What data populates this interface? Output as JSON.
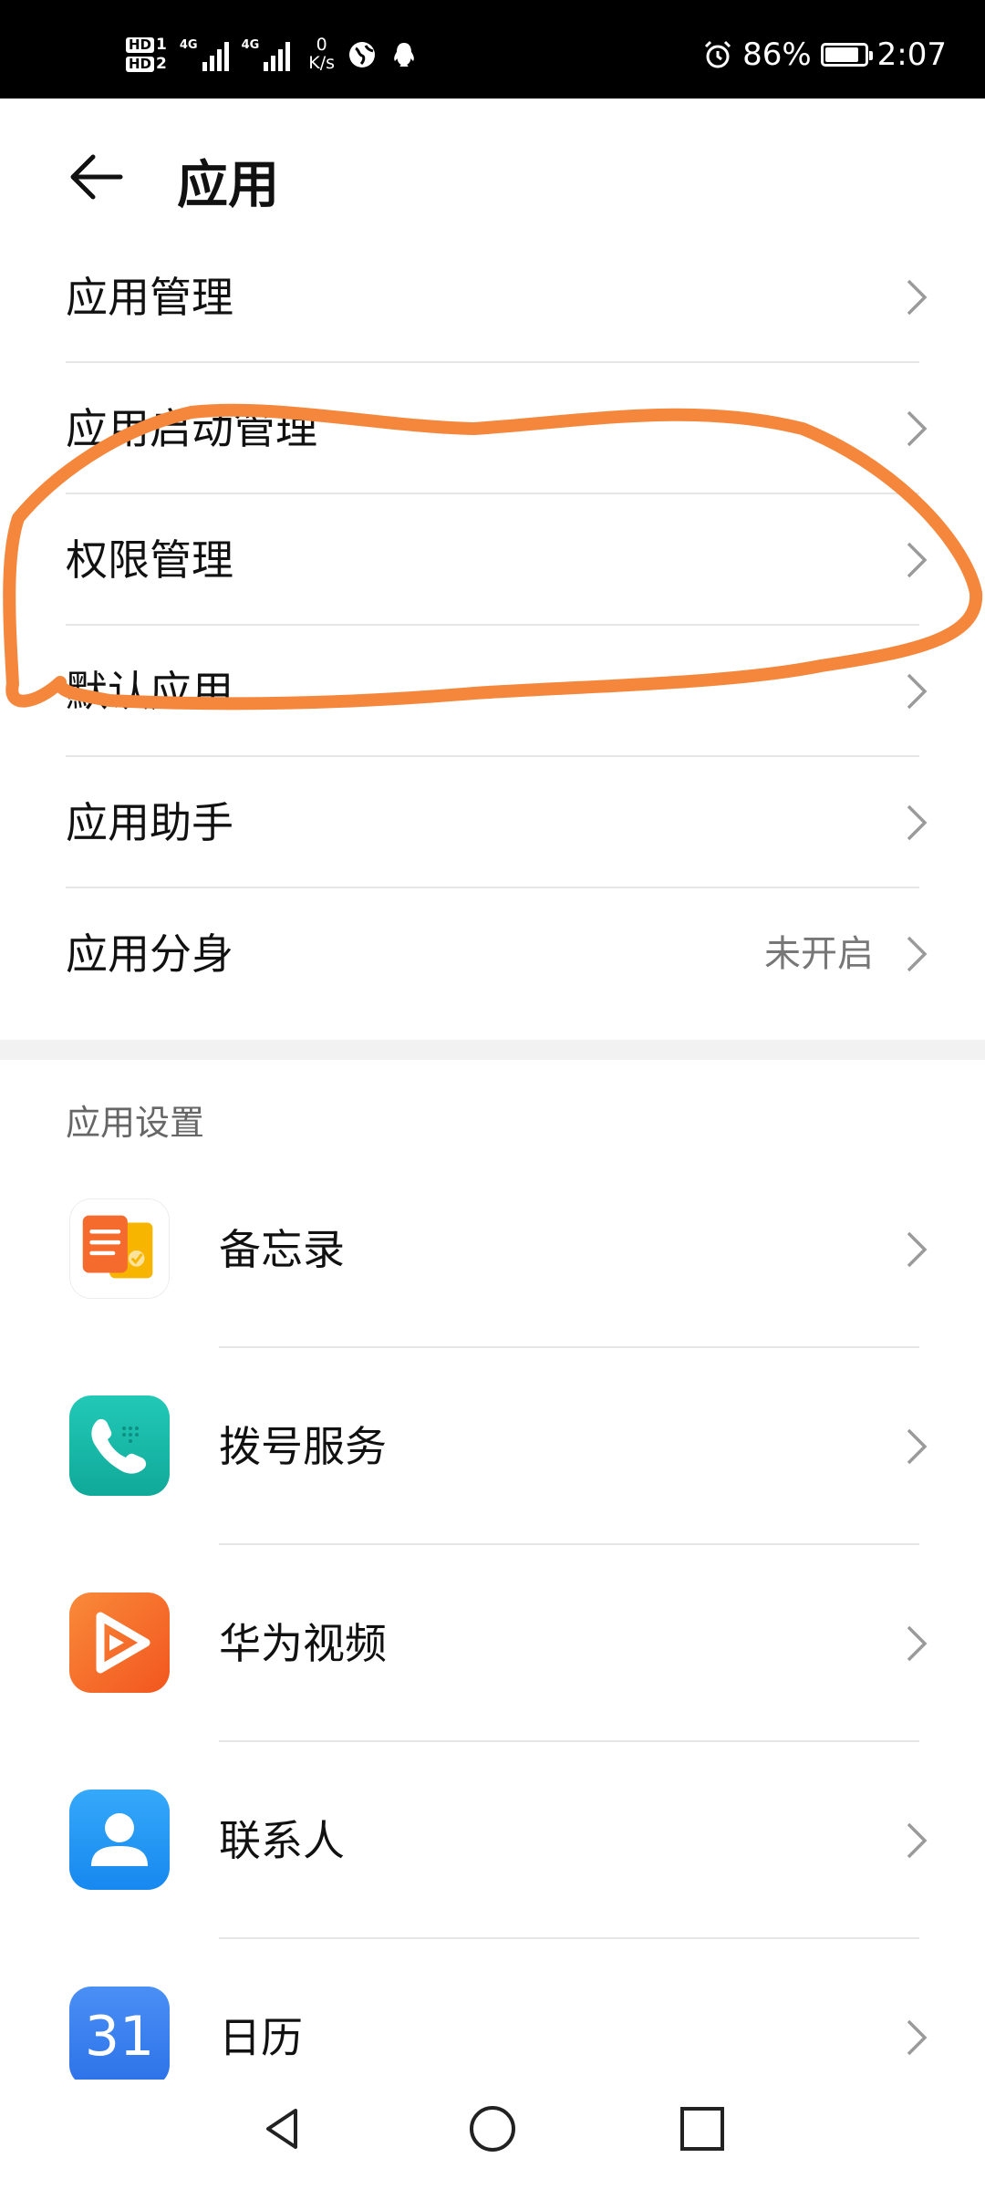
{
  "status_bar": {
    "hd1": "HD",
    "sim1": "1",
    "hd2": "HD",
    "sim2": "2",
    "net1": "4G",
    "net2": "4G",
    "speed_value": "0",
    "speed_unit": "K/s",
    "battery_text": "86%",
    "battery_level": 0.86,
    "time": "2:07",
    "icons": [
      "browser-icon",
      "qq-icon",
      "alarm-icon",
      "battery-icon"
    ]
  },
  "header": {
    "back_icon": "arrow-left-icon",
    "title": "应用"
  },
  "menu": [
    {
      "label": "应用管理",
      "value": ""
    },
    {
      "label": "应用启动管理",
      "value": ""
    },
    {
      "label": "权限管理",
      "value": ""
    },
    {
      "label": "默认应用",
      "value": ""
    },
    {
      "label": "应用助手",
      "value": ""
    },
    {
      "label": "应用分身",
      "value": "未开启"
    }
  ],
  "section": {
    "title": "应用设置"
  },
  "apps": [
    {
      "label": "备忘录",
      "icon": "notepad-icon",
      "color": "#f5a623"
    },
    {
      "label": "拨号服务",
      "icon": "phone-icon",
      "color": "#1bbfa8"
    },
    {
      "label": "华为视频",
      "icon": "video-play-icon",
      "color": "#f56a2a"
    },
    {
      "label": "联系人",
      "icon": "contact-icon",
      "color": "#1f9af5"
    },
    {
      "label": "日历",
      "icon": "calendar-icon",
      "color": "#3a82f0",
      "icon_text": "31"
    }
  ],
  "colors": {
    "annotation": "#f4873c"
  },
  "navbar": {
    "icons": [
      "back-triangle-icon",
      "home-circle-icon",
      "recents-square-icon"
    ]
  }
}
